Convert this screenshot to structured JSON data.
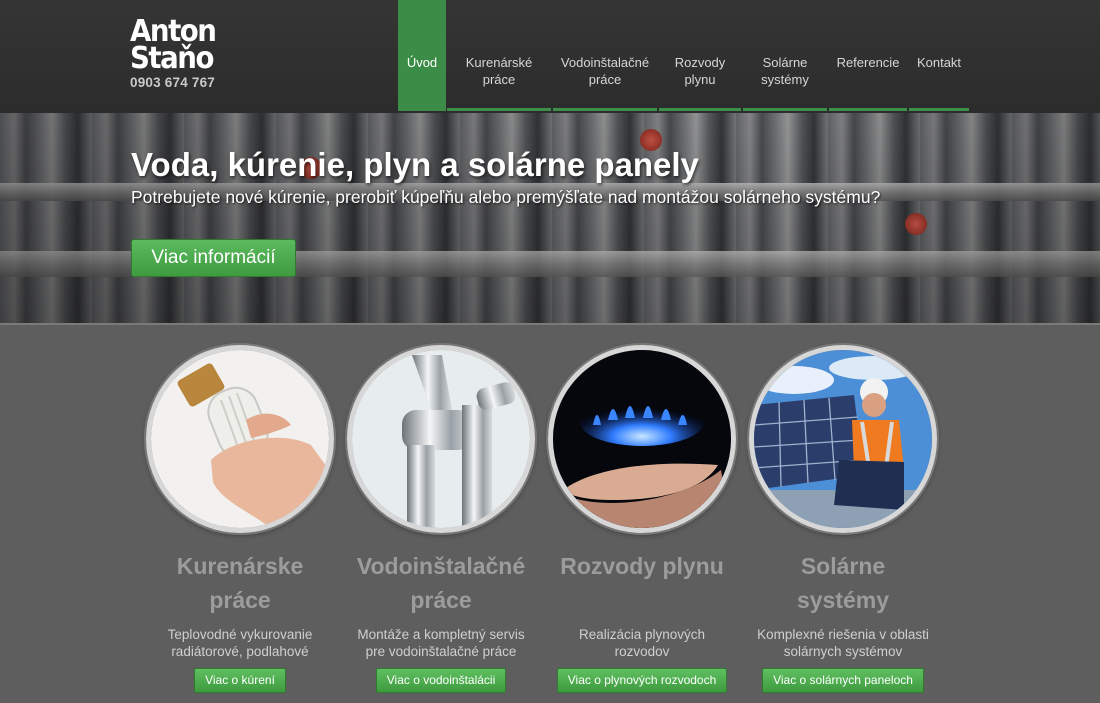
{
  "header": {
    "logo": {
      "name": "Anton\nStaňo",
      "phone": "0903 674 767"
    },
    "nav": [
      {
        "label": "Úvod",
        "active": true
      },
      {
        "label": "Kurenárské\npráce",
        "active": false
      },
      {
        "label": "Vodoinštalačné\npráce",
        "active": false
      },
      {
        "label": "Rozvody\nplynu",
        "active": false
      },
      {
        "label": "Solárne\nsystémy",
        "active": false
      },
      {
        "label": "Referencie",
        "active": false
      },
      {
        "label": "Kontakt",
        "active": false
      }
    ]
  },
  "hero": {
    "title": "Voda, kúrenie, plyn a solárne panely",
    "subtitle": "Potrebujete nové kúrenie, prerobiť kúpeľňu alebo premýšľate nad montážou solárneho systému?",
    "button": "Viac informácií"
  },
  "services": [
    {
      "title": "Kurenárske\npráce",
      "text": "Teplovodné vykurovanie\nradiátorové, podlahové",
      "button": "Viac o kúrení",
      "icon": "thermostat-valve-icon"
    },
    {
      "title": "Vodoinštalačné\npráce",
      "text": "Montáže a kompletný servis\npre vodoinštalačné práce",
      "button": "Viac o vodoinštalácii",
      "icon": "water-faucet-icon"
    },
    {
      "title": "Rozvody plynu",
      "text": "Realizácia plynových\nrozvodov",
      "button": "Viac o plynových rozvodoch",
      "icon": "gas-flame-icon"
    },
    {
      "title": "Solárne\nsystémy",
      "text": "Komplexné riešenia v oblasti\nsolárnych systémov",
      "button": "Viac o solárnych paneloch",
      "icon": "solar-panel-worker-icon"
    }
  ],
  "colors": {
    "accent_green": "#3a8c47",
    "header_bg": "#2f2f2f",
    "body_bg": "#5e5e5e",
    "service_title": "#9c9c9c"
  }
}
